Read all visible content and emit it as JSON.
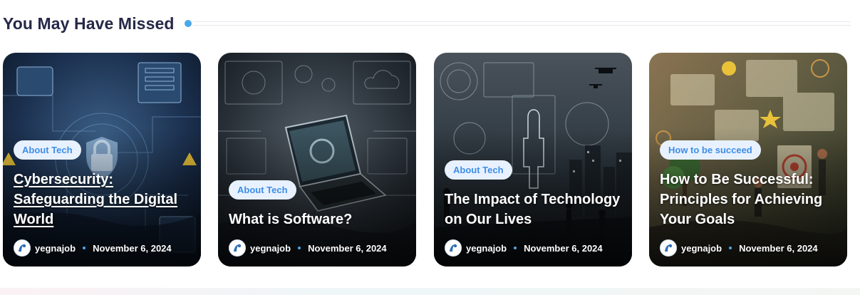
{
  "section": {
    "title": "You May Have Missed",
    "accent_color": "#4aa8e8"
  },
  "posts": [
    {
      "category": "About Tech",
      "title": "Cybersecurity: Safeguarding the Digital World",
      "author": "yegnajob",
      "date": "November 6, 2024",
      "image_icon": "cybersecurity-illustration"
    },
    {
      "category": "About Tech",
      "title": "What is Software?",
      "author": "yegnajob",
      "date": "November 6, 2024",
      "image_icon": "laptop-software-illustration"
    },
    {
      "category": "About Tech",
      "title": "The Impact of Technology on Our Lives",
      "author": "yegnajob",
      "date": "November 6, 2024",
      "image_icon": "futuristic-city-illustration"
    },
    {
      "category": "How to be succeed",
      "title": "How to Be Successful: Principles for Achieving Your Goals",
      "author": "yegnajob",
      "date": "November 6, 2024",
      "image_icon": "smart-goals-illustration"
    }
  ]
}
